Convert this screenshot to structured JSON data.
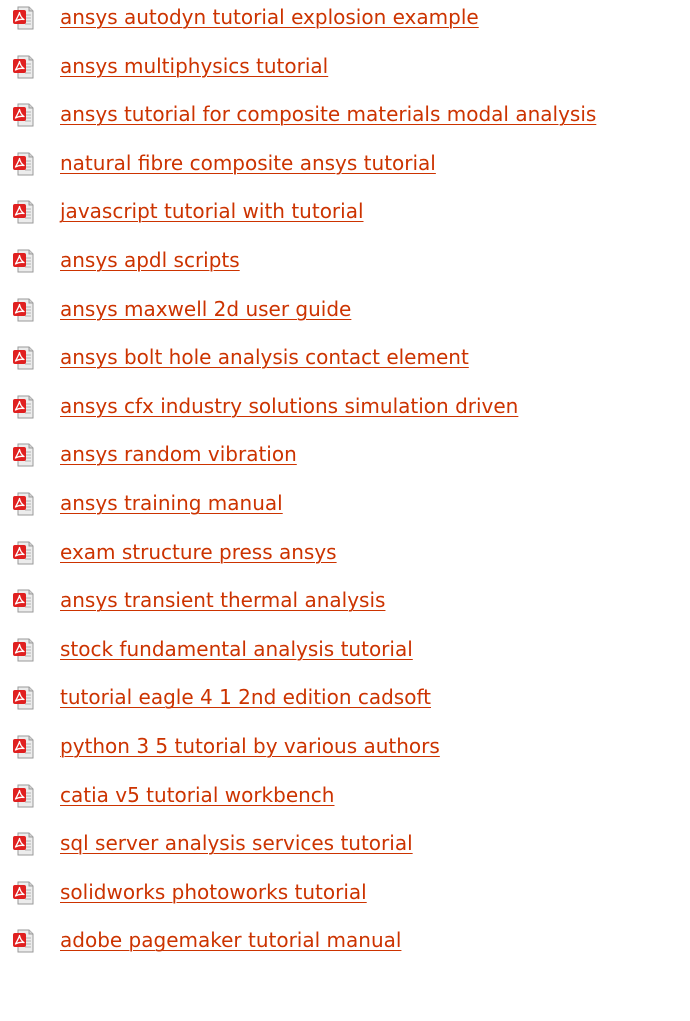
{
  "documents": [
    {
      "title": "ansys autodyn tutorial explosion example",
      "icon": "pdf-icon"
    },
    {
      "title": "ansys multiphysics tutorial",
      "icon": "pdf-icon"
    },
    {
      "title": "ansys tutorial for composite materials modal analysis",
      "icon": "pdf-icon"
    },
    {
      "title": "natural fibre composite ansys tutorial",
      "icon": "pdf-icon"
    },
    {
      "title": "javascript tutorial with tutorial",
      "icon": "pdf-icon"
    },
    {
      "title": "ansys apdl scripts",
      "icon": "pdf-icon"
    },
    {
      "title": "ansys maxwell 2d user guide",
      "icon": "pdf-icon"
    },
    {
      "title": "ansys bolt hole analysis contact element",
      "icon": "pdf-icon"
    },
    {
      "title": "ansys cfx industry solutions simulation driven",
      "icon": "pdf-icon"
    },
    {
      "title": "ansys random vibration",
      "icon": "pdf-icon"
    },
    {
      "title": "ansys training manual",
      "icon": "pdf-icon"
    },
    {
      "title": "exam structure press ansys",
      "icon": "pdf-icon"
    },
    {
      "title": "ansys transient thermal analysis",
      "icon": "pdf-icon"
    },
    {
      "title": "stock fundamental analysis tutorial",
      "icon": "pdf-icon"
    },
    {
      "title": "tutorial eagle 4 1 2nd edition cadsoft",
      "icon": "pdf-icon"
    },
    {
      "title": "python 3 5 tutorial by various authors",
      "icon": "pdf-icon"
    },
    {
      "title": "catia v5 tutorial workbench",
      "icon": "pdf-icon"
    },
    {
      "title": "sql server analysis services tutorial",
      "icon": "pdf-icon"
    },
    {
      "title": "solidworks photoworks tutorial",
      "icon": "pdf-icon"
    },
    {
      "title": "adobe pagemaker tutorial manual",
      "icon": "pdf-icon"
    }
  ],
  "colors": {
    "link": "#cc3300",
    "icon_red": "#e02020",
    "icon_page": "#d9d9d9"
  }
}
